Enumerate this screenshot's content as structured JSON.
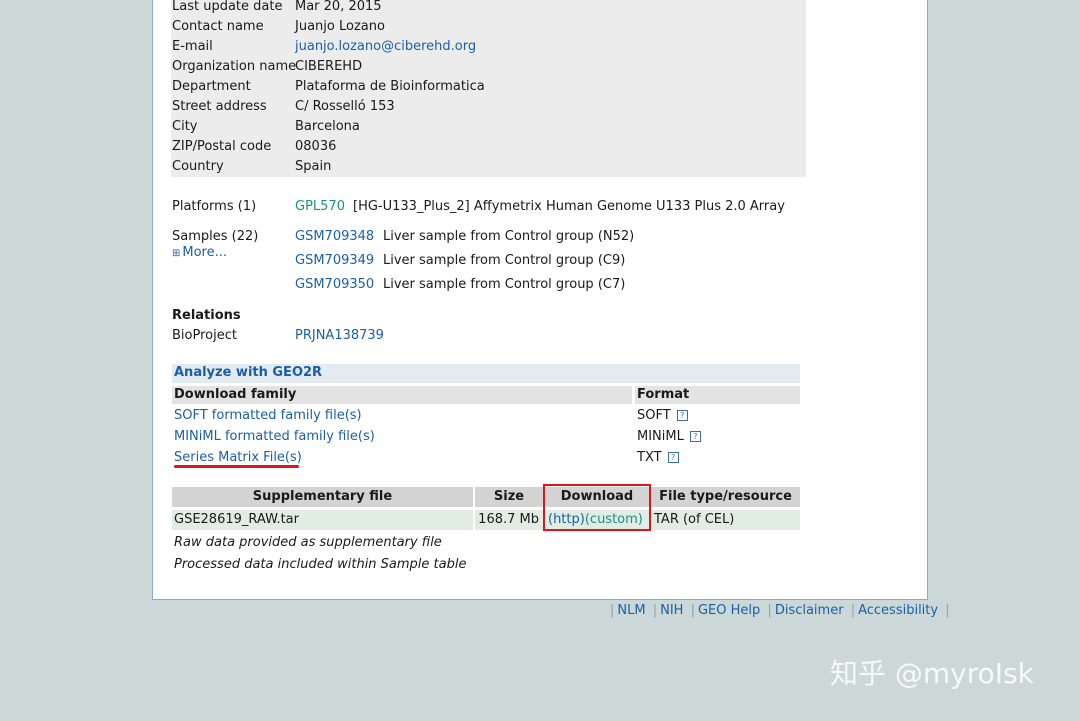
{
  "contact": {
    "rows": [
      {
        "label": "Last update date",
        "value": "Mar 20, 2015"
      },
      {
        "label": "Contact name",
        "value": "Juanjo Lozano"
      },
      {
        "label": "E-mail",
        "value": "juanjo.lozano@ciberehd.org"
      },
      {
        "label": "Organization name",
        "value": "CIBEREHD"
      },
      {
        "label": "Department",
        "value": "Plataforma de Bioinformatica"
      },
      {
        "label": "Street address",
        "value": "C/ Rosselló 153"
      },
      {
        "label": "City",
        "value": "Barcelona"
      },
      {
        "label": "ZIP/Postal code",
        "value": "08036"
      },
      {
        "label": "Country",
        "value": "Spain"
      }
    ]
  },
  "platforms": {
    "label": "Platforms (1)",
    "id": "GPL570",
    "desc": "[HG-U133_Plus_2] Affymetrix Human Genome U133 Plus 2.0 Array"
  },
  "samples": {
    "label": "Samples (22)",
    "more": "More...",
    "items": [
      {
        "id": "GSM709348",
        "desc": "Liver sample from Control group (N52)"
      },
      {
        "id": "GSM709349",
        "desc": "Liver sample from Control group (C9)"
      },
      {
        "id": "GSM709350",
        "desc": "Liver sample from Control group (C7)"
      }
    ]
  },
  "relations": {
    "title": "Relations",
    "bioproject_label": "BioProject",
    "bioproject_id": "PRJNA138739"
  },
  "analyze": "Analyze with GEO2R",
  "download_family": {
    "header": "Download family",
    "format_header": "Format",
    "rows": [
      {
        "link": "SOFT formatted family file(s)",
        "format": "SOFT"
      },
      {
        "link": "MINiML formatted family file(s)",
        "format": "MINiML"
      },
      {
        "link": "Series Matrix File(s)",
        "format": "TXT"
      }
    ],
    "help_glyph": "?"
  },
  "supplementary": {
    "headers": [
      "Supplementary file",
      "Size",
      "Download",
      "File type/resource"
    ],
    "row": {
      "file": "GSE28619_RAW.tar",
      "size": "168.7 Mb",
      "http": "(http)",
      "custom": "(custom)",
      "type": "TAR (of CEL)"
    },
    "notes": [
      "Raw data provided as supplementary file",
      "Processed data included within Sample table"
    ]
  },
  "footer": {
    "links": [
      "NLM",
      "NIH",
      "GEO Help",
      "Disclaimer",
      "Accessibility"
    ],
    "sep": "|"
  },
  "watermark": "知乎 @myroIsk",
  "colors": {
    "link": "#1a5fa8",
    "teal_link": "#1c8f87",
    "highlight": "#e0141c",
    "background": "#cbd8d7"
  }
}
